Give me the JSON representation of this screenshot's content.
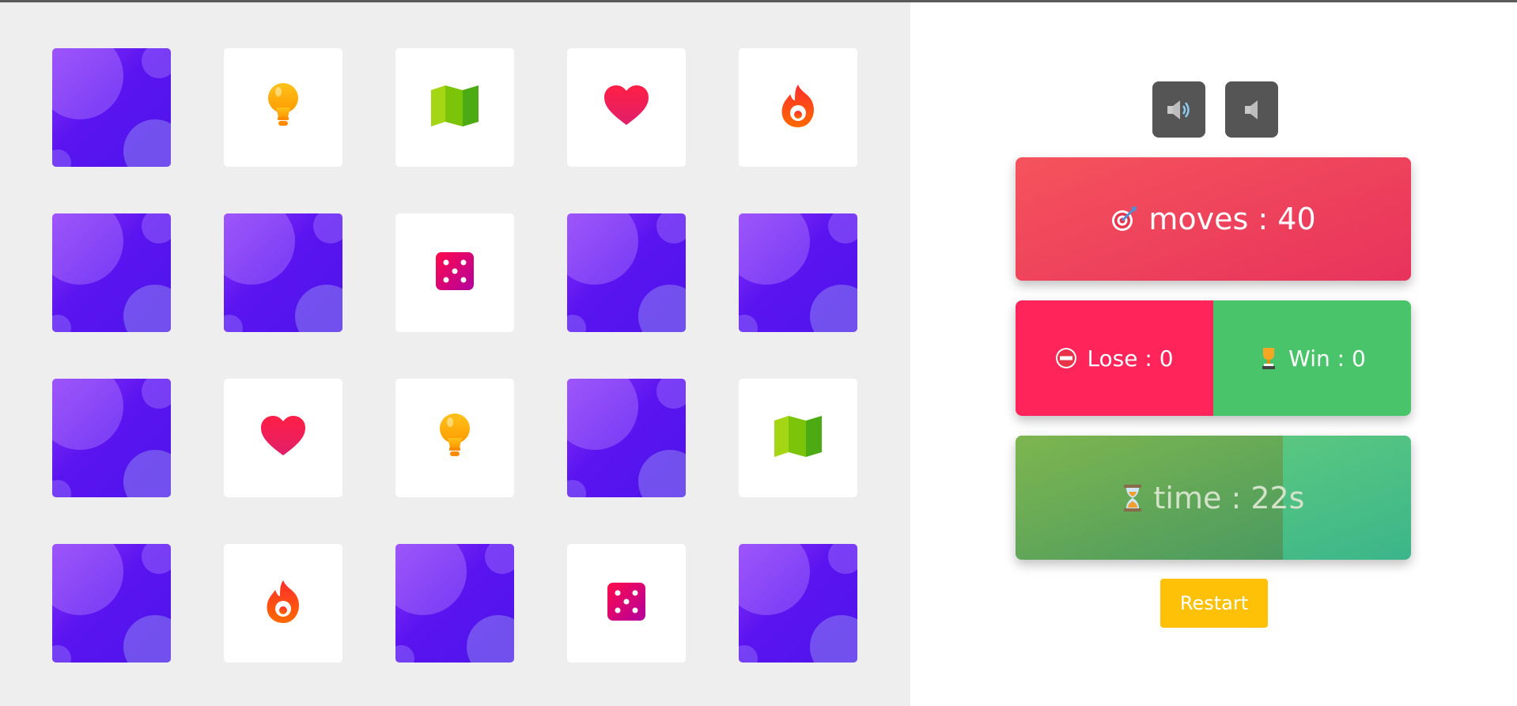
{
  "board": {
    "rows": 4,
    "cols": 5,
    "cards": [
      {
        "state": "hidden",
        "symbol": ""
      },
      {
        "state": "revealed",
        "symbol": "lightbulb-icon"
      },
      {
        "state": "revealed",
        "symbol": "map-icon"
      },
      {
        "state": "revealed",
        "symbol": "heart-icon"
      },
      {
        "state": "revealed",
        "symbol": "fire-icon"
      },
      {
        "state": "hidden",
        "symbol": ""
      },
      {
        "state": "hidden",
        "symbol": ""
      },
      {
        "state": "revealed",
        "symbol": "dice-icon"
      },
      {
        "state": "hidden",
        "symbol": ""
      },
      {
        "state": "hidden",
        "symbol": ""
      },
      {
        "state": "hidden",
        "symbol": ""
      },
      {
        "state": "revealed",
        "symbol": "heart-icon"
      },
      {
        "state": "revealed",
        "symbol": "lightbulb-icon"
      },
      {
        "state": "hidden",
        "symbol": ""
      },
      {
        "state": "revealed",
        "symbol": "map-icon"
      },
      {
        "state": "hidden",
        "symbol": ""
      },
      {
        "state": "revealed",
        "symbol": "fire-icon"
      },
      {
        "state": "hidden",
        "symbol": ""
      },
      {
        "state": "revealed",
        "symbol": "dice-icon"
      },
      {
        "state": "hidden",
        "symbol": ""
      }
    ]
  },
  "sound": {
    "on_icon": "speaker-on-icon",
    "off_icon": "speaker-off-icon"
  },
  "stats": {
    "moves_label": "moves : 40",
    "moves_icon": "target-icon",
    "lose_label": "Lose : 0",
    "lose_icon": "no-entry-icon",
    "win_label": "Win : 0",
    "win_icon": "trophy-icon",
    "time_label": "time : 22s",
    "time_icon": "hourglass-icon",
    "time_progress": 0.676
  },
  "restart_label": "Restart",
  "colors": {
    "card_back": "#5a14f0",
    "moves_bg": "#ee4060",
    "lose_bg": "#ff2459",
    "win_bg": "#4ac46a",
    "time_bg": "#4fbf80",
    "restart_bg": "#ffc107"
  }
}
